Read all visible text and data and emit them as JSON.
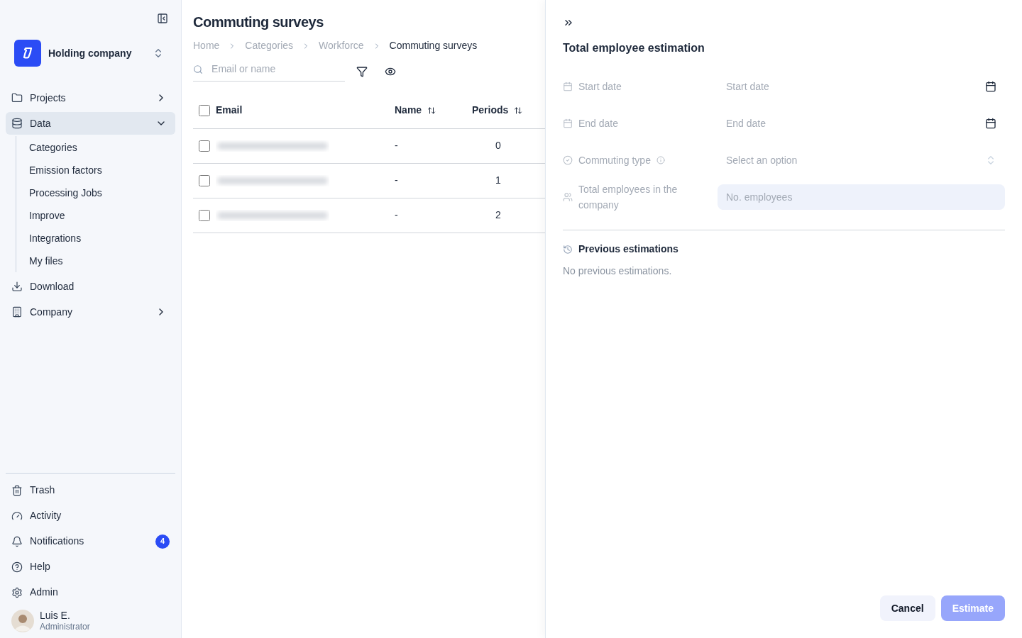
{
  "sidebar": {
    "company": {
      "name": "Holding company"
    },
    "nav": [
      {
        "label": "Projects",
        "kind": "group",
        "expanded": false,
        "selected": false
      },
      {
        "label": "Data",
        "kind": "group",
        "expanded": true,
        "selected": true,
        "children": [
          {
            "label": "Categories"
          },
          {
            "label": "Emission factors"
          },
          {
            "label": "Processing Jobs"
          },
          {
            "label": "Improve"
          },
          {
            "label": "Integrations"
          },
          {
            "label": "My files"
          }
        ]
      },
      {
        "label": "Download",
        "kind": "link",
        "selected": false
      },
      {
        "label": "Company",
        "kind": "group",
        "expanded": false,
        "selected": false
      }
    ],
    "bottom_nav": [
      {
        "label": "Trash"
      },
      {
        "label": "Activity"
      },
      {
        "label": "Notifications",
        "badge": "4"
      },
      {
        "label": "Help"
      },
      {
        "label": "Admin"
      }
    ],
    "user": {
      "name": "Luis E.",
      "role": "Administrator"
    }
  },
  "page": {
    "title": "Commuting surveys",
    "breadcrumbs": [
      {
        "label": "Home",
        "current": false
      },
      {
        "label": "Categories",
        "current": false
      },
      {
        "label": "Workforce",
        "current": false
      },
      {
        "label": "Commuting surveys",
        "current": true
      }
    ],
    "search": {
      "placeholder": "Email or name"
    },
    "table": {
      "all_checked": false,
      "columns": [
        {
          "label": "Email",
          "sortable": false
        },
        {
          "label": "Name",
          "sortable": true
        },
        {
          "label": "Periods",
          "sortable": true
        }
      ],
      "rows": [
        {
          "checked": false,
          "email_redacted": true,
          "name": "-",
          "periods": "0"
        },
        {
          "checked": false,
          "email_redacted": true,
          "name": "-",
          "periods": "1"
        },
        {
          "checked": false,
          "email_redacted": true,
          "name": "-",
          "periods": "2"
        }
      ]
    }
  },
  "panel": {
    "title": "Total employee estimation",
    "fields": [
      {
        "kind": "date",
        "label": "Start date",
        "placeholder": "Start date"
      },
      {
        "kind": "date",
        "label": "End date",
        "placeholder": "End date"
      },
      {
        "kind": "select",
        "label": "Commuting type",
        "info": true,
        "placeholder": "Select an option"
      },
      {
        "kind": "number",
        "label": "Total employees in the company",
        "placeholder": "No. employees"
      }
    ],
    "history": {
      "title": "Previous estimations",
      "empty": "No previous estimations."
    },
    "buttons": [
      {
        "label": "Cancel",
        "kind": "secondary",
        "disabled": false
      },
      {
        "label": "Estimate",
        "kind": "primary",
        "disabled": true
      }
    ]
  }
}
